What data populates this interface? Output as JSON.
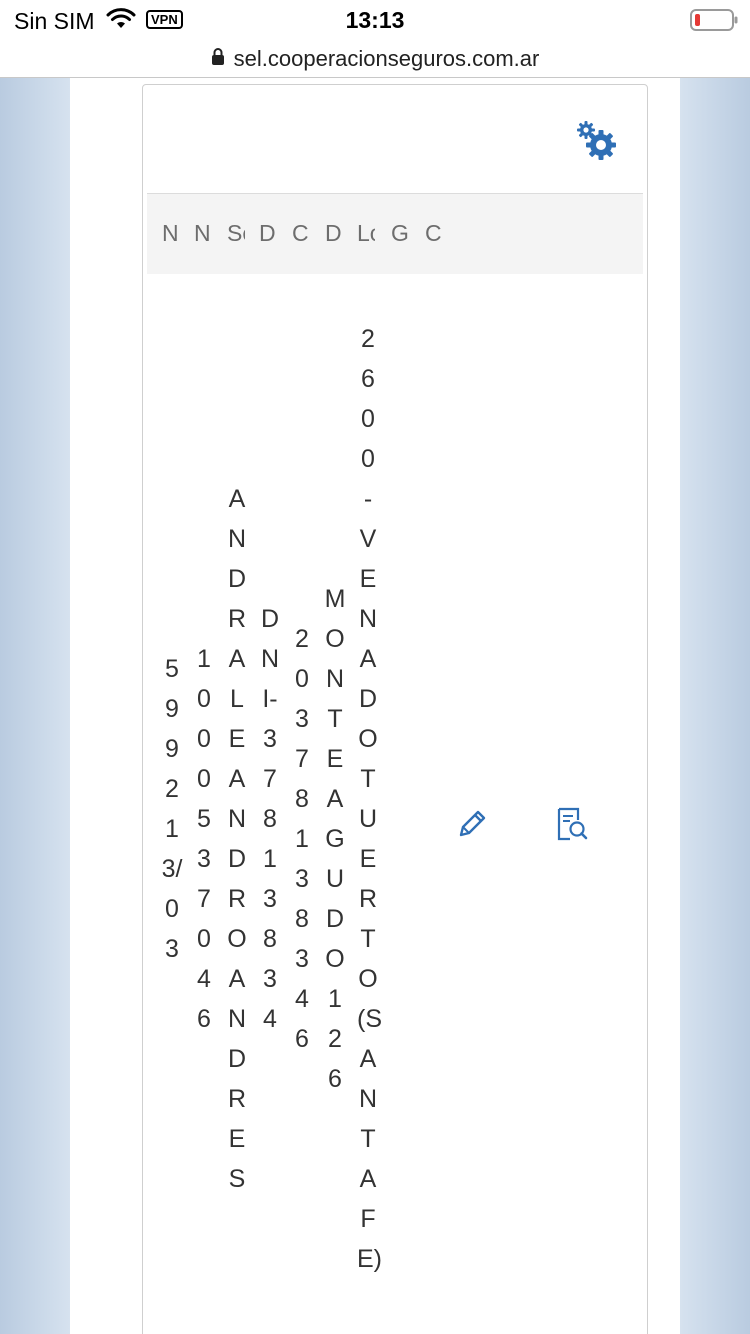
{
  "status_bar": {
    "carrier": "Sin SIM",
    "vpn": "VPN",
    "time": "13:13"
  },
  "browser": {
    "url": "sel.cooperacionseguros.com.ar"
  },
  "table": {
    "headers": [
      "N",
      "N",
      "Se",
      "D",
      "C",
      "D",
      "Lo",
      "G",
      "C"
    ],
    "row": {
      "cells": [
        "599213/03",
        "1000537046",
        "ANDRALEANDROANDRES",
        "DNI-37813834",
        "20378138346",
        "MONTEAGUDO126",
        "2600-VENADOTUERTO(SANTAFE)"
      ]
    }
  },
  "icons": {
    "settings": "gears-icon",
    "edit": "pencil-icon",
    "view": "document-search-icon"
  },
  "colors": {
    "accent": "#2f6fb5",
    "battery_low": "#e53935"
  }
}
